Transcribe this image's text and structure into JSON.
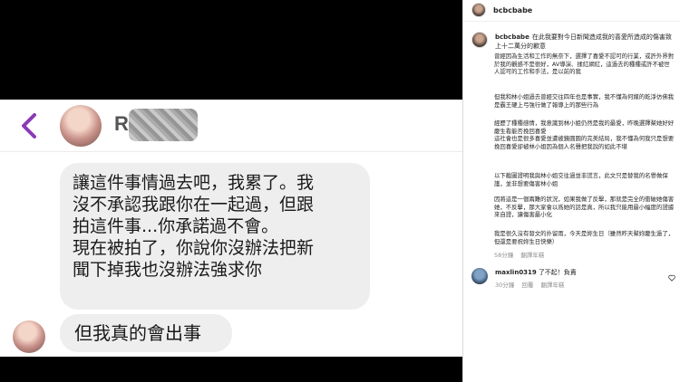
{
  "chat": {
    "header_name_initial": "R",
    "message_1_lines": [
      "讓這件事情過去吧，我累了。我",
      "沒不承認我跟你在一起過，但跟",
      "拍這件事...你承諾過不會。",
      "現在被拍了，你說你沒辦法把新",
      "聞下掉我也沒辦法強求你"
    ],
    "message_2": "但我真的會出事"
  },
  "post": {
    "owner_username": "bcbcbabe",
    "caption_intro": "在此我要對今日新聞造成我的喜愛所造成的傷害致上十二萬分的歉意",
    "paragraphs": [
      "曾經因為生活和工作的無奈下，選擇了喜愛不認可的行業，或許外界對於我的觀感不是很好，AV導演、揉紅網紅，這過去的種種或許不被世人認可的工作和手法，是以前的我",
      "但我和林小姐過去曾經交往四年也是事實，我不懂為何媒的乾淨仿佛我是霸王硬上弓強行做了報導上的那些行為",
      "經歷了種種感情，我意識到林小姐仍然是我的最愛，昨晚選擇幫她好好慶生看能否挽回喜愛\n這社會也是很多喜愛並遭被鏡圓圓的完美結局，我不懂為何我只是想要挽回喜愛卻被林小姐因為個人名聲把我說的如此不堪",
      "以下截圖證明我與林小姐交往過並非謊言，此文只是替我的名譽做保護，並非想要傷害林小姐",
      "因將這是一個兩難的狀況，如果我做了反擊，那就是完全的衝破她傷害她，不反擊，那大家會以爲她的話是真，所以我只能用最小幅度的證據來自證，讓傷害最小化",
      "我是很久沒有發文的扑留雨，今天是妳生日（雖然昨天幫妳慶生過了，但還是要祝妳生日快樂）"
    ],
    "caption_meta": {
      "time": "58分鐘",
      "translate": "翻譯年糕"
    },
    "comment": {
      "username": "maxlin0319",
      "text": "了不起！負責",
      "time": "30分鐘",
      "replies": "回覆",
      "translate": "翻譯年糕"
    }
  },
  "colors": {
    "accent_purple": "#8a3ab9",
    "bubble_gray": "#eeeeee",
    "muted_text": "#8e8e8e"
  }
}
